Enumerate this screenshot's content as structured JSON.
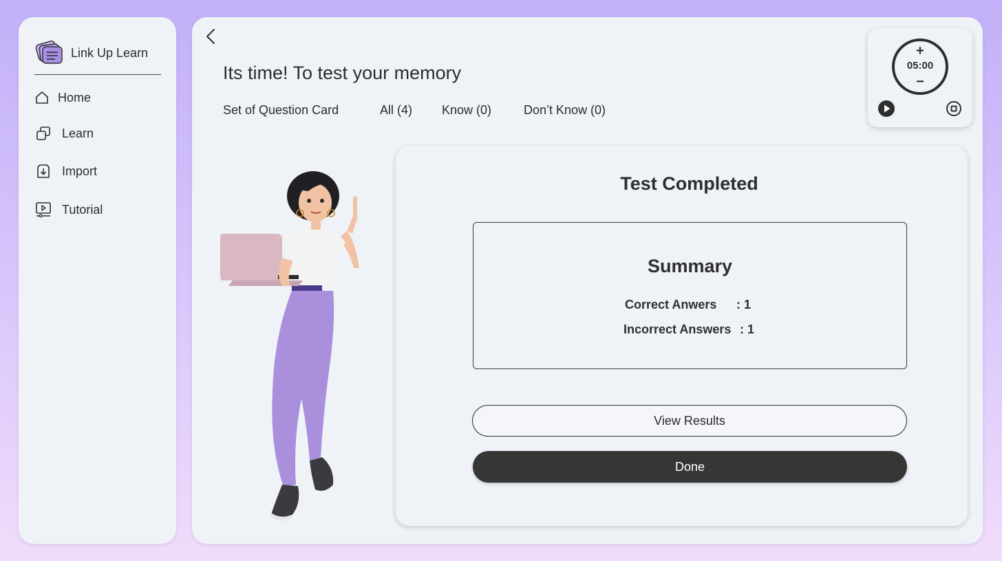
{
  "sidebar": {
    "brand_name": "Link Up Learn",
    "items": [
      {
        "label": "Home",
        "icon": "home-icon"
      },
      {
        "label": "Learn",
        "icon": "layers-icon"
      },
      {
        "label": "Import",
        "icon": "import-icon"
      },
      {
        "label": "Tutorial",
        "icon": "video-icon"
      }
    ]
  },
  "header": {
    "title": "Its time! To test your memory",
    "tabs": [
      {
        "label": "Set of Question Card"
      },
      {
        "label": "All (4)"
      },
      {
        "label": "Know (0)"
      },
      {
        "label": "Don’t Know (0)"
      }
    ]
  },
  "timer": {
    "time": "05:00",
    "plus_label": "+",
    "minus_label": "−"
  },
  "result": {
    "title": "Test Completed",
    "summary_title": "Summary",
    "correct_label": "Correct Anwers",
    "correct_value": ": 1",
    "incorrect_label": "Incorrect Answers",
    "incorrect_value": ": 1",
    "view_results_label": "View Results",
    "done_label": "Done"
  },
  "colors": {
    "background_top": "#c2b0f8",
    "background_bottom": "#f1dcfb",
    "panel": "#eff3f8",
    "primary_button": "#363636",
    "illustration_pants": "#a98fdc"
  }
}
